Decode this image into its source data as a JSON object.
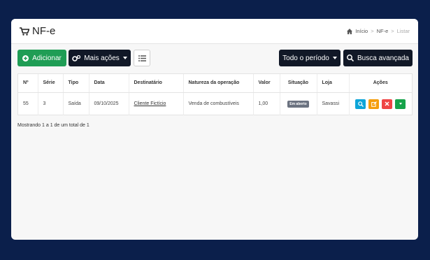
{
  "header": {
    "title": "NF-e"
  },
  "breadcrumb": {
    "home": "Início",
    "section": "NF-e",
    "current": "Listar"
  },
  "toolbar": {
    "add_label": "Adicionar",
    "more_label": "Mais ações",
    "period_label": "Todo o período",
    "search_label": "Busca avançada"
  },
  "table": {
    "headers": [
      "Nº",
      "Série",
      "Tipo",
      "Data",
      "Destinatário",
      "Natureza da operação",
      "Valor",
      "Situação",
      "Loja",
      "Ações"
    ],
    "rows": [
      {
        "numero": "55",
        "serie": "3",
        "tipo": "Saída",
        "data": "09/10/2025",
        "destinatario": "Cliente Fictício",
        "natureza": "Venda de combustíveis",
        "valor": "1,00",
        "situacao": "Em aberto",
        "loja": "Savassi"
      }
    ]
  },
  "footer": {
    "summary": "Mostrando 1 a 1 de um total de 1"
  },
  "colors": {
    "background": "#0b1f4b",
    "green": "#1f9d55",
    "dark": "#111827",
    "cyan": "#0ea5d8",
    "orange": "#f59e0b",
    "red": "#ef4444"
  }
}
